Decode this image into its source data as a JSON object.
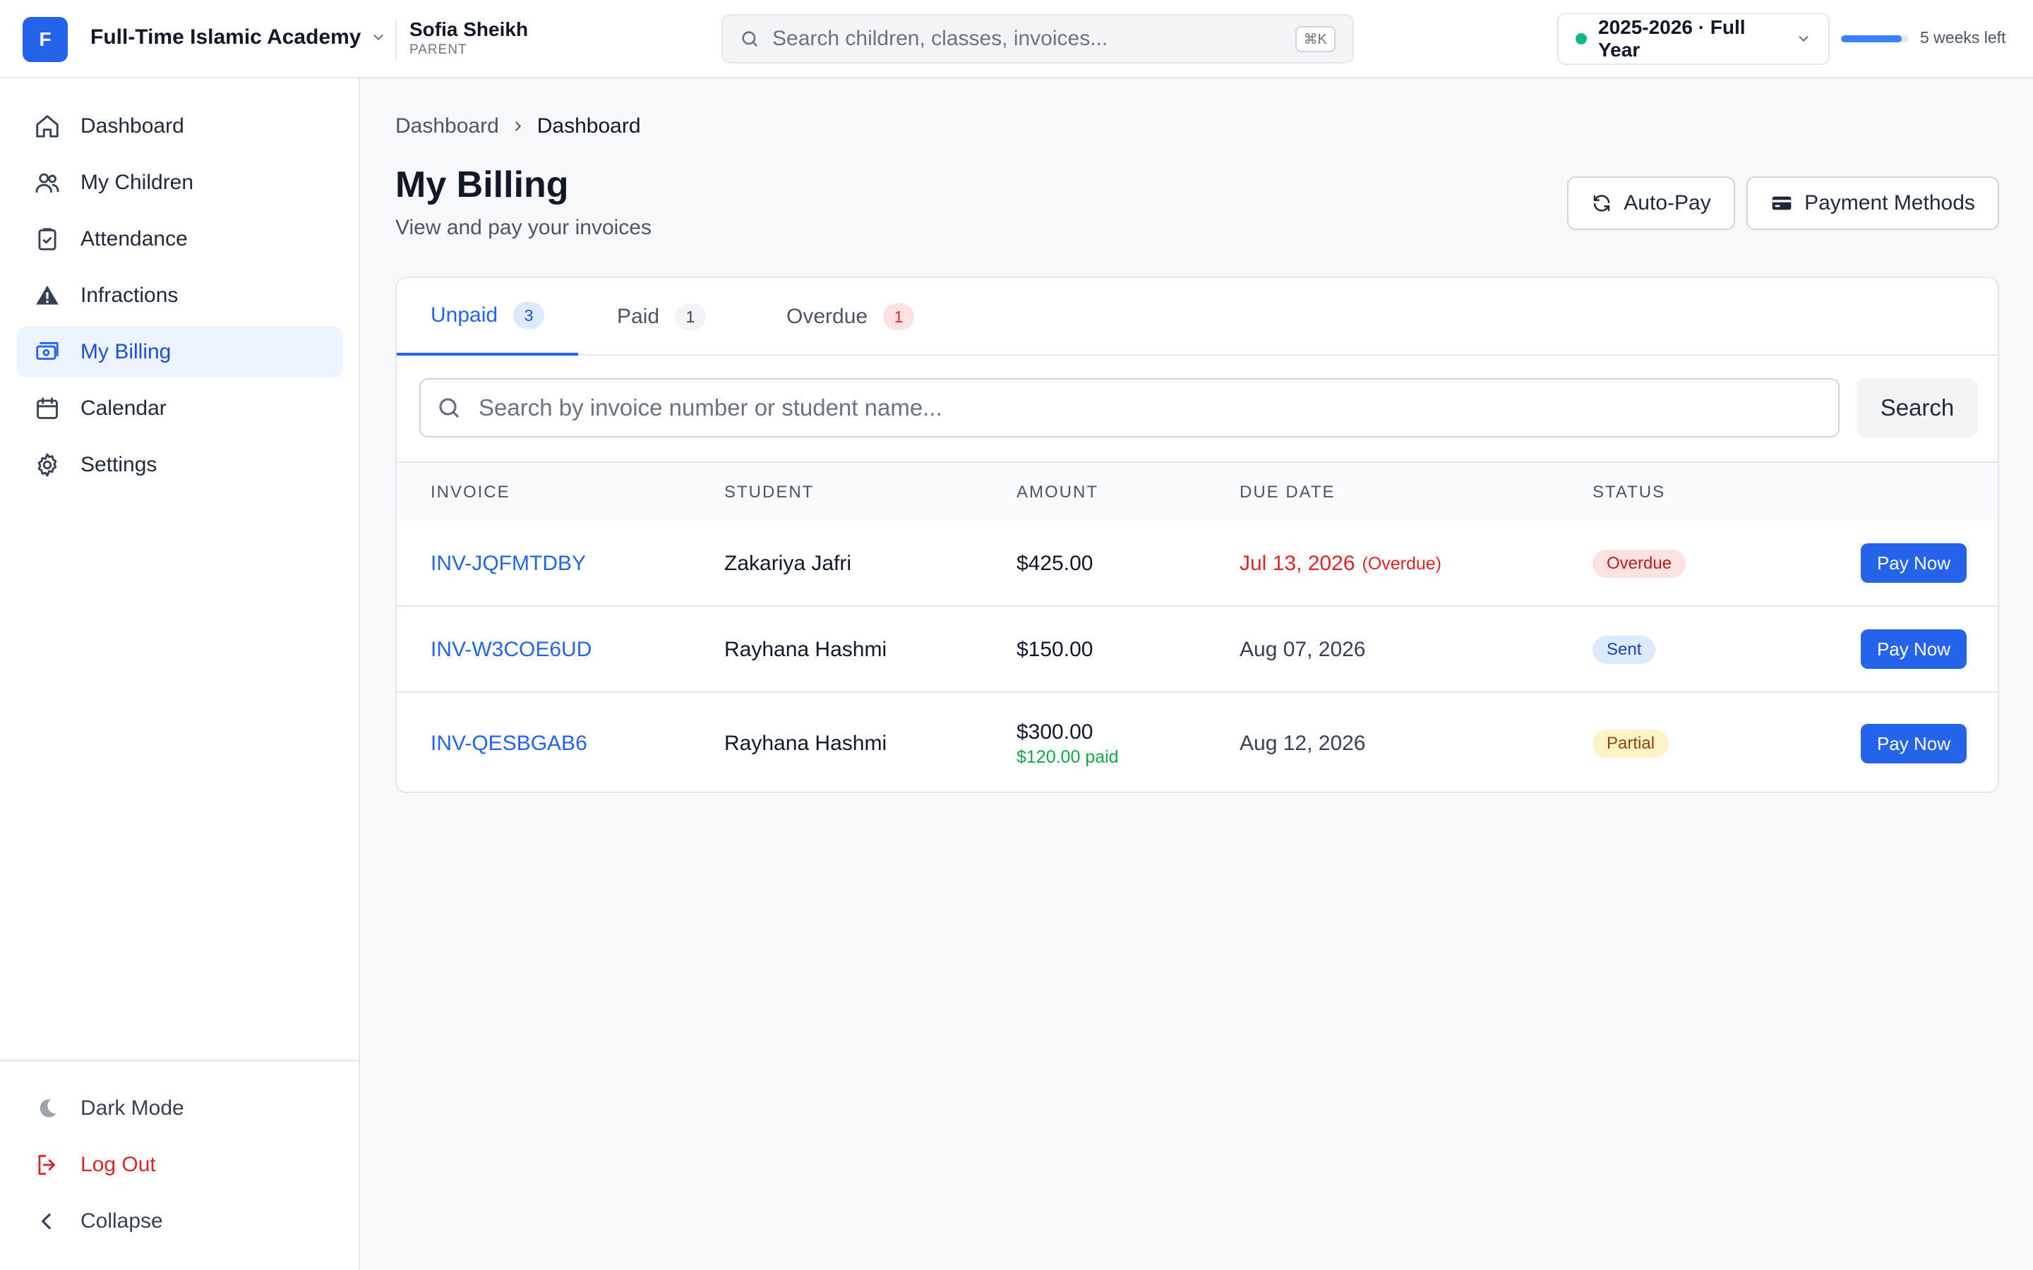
{
  "topbar": {
    "logo_letter": "F",
    "org_name": "Full-Time Islamic Academy",
    "user_name": "Sofia Sheikh",
    "user_role": "PARENT",
    "search_placeholder": "Search children, classes, invoices...",
    "search_shortcut": "⌘K",
    "year_label": "2025-2026 · Full Year",
    "year_status_color": "#10b981",
    "year_progress_fraction": 0.9,
    "weeks_left": "5 weeks left"
  },
  "sidebar": {
    "items": [
      {
        "label": "Dashboard",
        "icon": "home-icon"
      },
      {
        "label": "My Children",
        "icon": "users-icon"
      },
      {
        "label": "Attendance",
        "icon": "clipboard-check-icon"
      },
      {
        "label": "Infractions",
        "icon": "warning-icon"
      },
      {
        "label": "My Billing",
        "icon": "billing-icon",
        "active": true
      },
      {
        "label": "Calendar",
        "icon": "calendar-icon"
      },
      {
        "label": "Settings",
        "icon": "gear-icon"
      }
    ],
    "bottom": {
      "dark_mode": "Dark Mode",
      "logout": "Log Out",
      "collapse": "Collapse"
    }
  },
  "main": {
    "breadcrumb": [
      "Dashboard",
      "Dashboard"
    ],
    "title": "My Billing",
    "subtitle": "View and pay your invoices",
    "actions": {
      "autopay": "Auto-Pay",
      "payment_methods": "Payment Methods"
    },
    "tabs": [
      {
        "label": "Unpaid",
        "count": "3",
        "active": true
      },
      {
        "label": "Paid",
        "count": "1"
      },
      {
        "label": "Overdue",
        "count": "1"
      }
    ],
    "table_search_placeholder": "Search by invoice number or student name...",
    "search_button": "Search",
    "columns": [
      "INVOICE",
      "STUDENT",
      "AMOUNT",
      "DUE DATE",
      "STATUS"
    ],
    "rows": [
      {
        "invoice": "INV-JQFMTDBY",
        "student": "Zakariya Jafri",
        "amount": "$425.00",
        "paid_note": "",
        "due": "Jul 13, 2026",
        "due_note": "(Overdue)",
        "status": "Overdue",
        "action": "Pay Now"
      },
      {
        "invoice": "INV-W3COE6UD",
        "student": "Rayhana Hashmi",
        "amount": "$150.00",
        "paid_note": "",
        "due": "Aug 07, 2026",
        "due_note": "",
        "status": "Sent",
        "action": "Pay Now"
      },
      {
        "invoice": "INV-QESBGAB6",
        "student": "Rayhana Hashmi",
        "amount": "$300.00",
        "paid_note": "$120.00 paid",
        "due": "Aug 12, 2026",
        "due_note": "",
        "status": "Partial",
        "action": "Pay Now"
      }
    ]
  },
  "colors": {
    "accent": "#2563eb",
    "overdue": "#dc2626",
    "paid": "#16a34a"
  }
}
